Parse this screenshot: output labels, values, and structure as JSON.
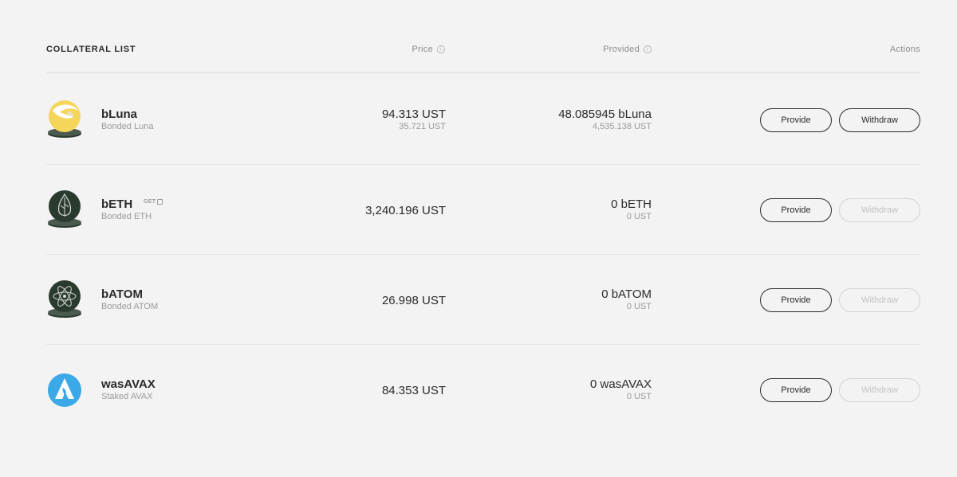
{
  "header": {
    "title": "COLLATERAL LIST",
    "price": "Price",
    "provided": "Provided",
    "actions": "Actions",
    "info_icon": "info-icon"
  },
  "rows": [
    {
      "symbol": "bLuna",
      "name": "Bonded Luna",
      "badge": "",
      "price": "94.313 UST",
      "price_sub": "35.721 UST",
      "provided": "48.085945 bLuna",
      "provided_sub": "4,535.138 UST",
      "provide_label": "Provide",
      "withdraw_label": "Withdraw",
      "withdraw_enabled": true,
      "icon": "bluna-icon"
    },
    {
      "symbol": "bETH",
      "name": "Bonded ETH",
      "badge": "GET",
      "price": "3,240.196 UST",
      "price_sub": "",
      "provided": "0 bETH",
      "provided_sub": "0 UST",
      "provide_label": "Provide",
      "withdraw_label": "Withdraw",
      "withdraw_enabled": false,
      "icon": "beth-icon"
    },
    {
      "symbol": "bATOM",
      "name": "Bonded ATOM",
      "badge": "",
      "price": "26.998 UST",
      "price_sub": "",
      "provided": "0 bATOM",
      "provided_sub": "0 UST",
      "provide_label": "Provide",
      "withdraw_label": "Withdraw",
      "withdraw_enabled": false,
      "icon": "batom-icon"
    },
    {
      "symbol": "wasAVAX",
      "name": "Staked AVAX",
      "badge": "",
      "price": "84.353 UST",
      "price_sub": "",
      "provided": "0 wasAVAX",
      "provided_sub": "0 UST",
      "provide_label": "Provide",
      "withdraw_label": "Withdraw",
      "withdraw_enabled": false,
      "icon": "wasavax-icon"
    }
  ],
  "colors": {
    "text": "#2a2a2a",
    "muted": "#9a9a9a",
    "divider": "#e6e6e6",
    "luna_yellow": "#f6d65a",
    "dark_green": "#2b3a2f",
    "avax_blue": "#3ba9e8"
  }
}
